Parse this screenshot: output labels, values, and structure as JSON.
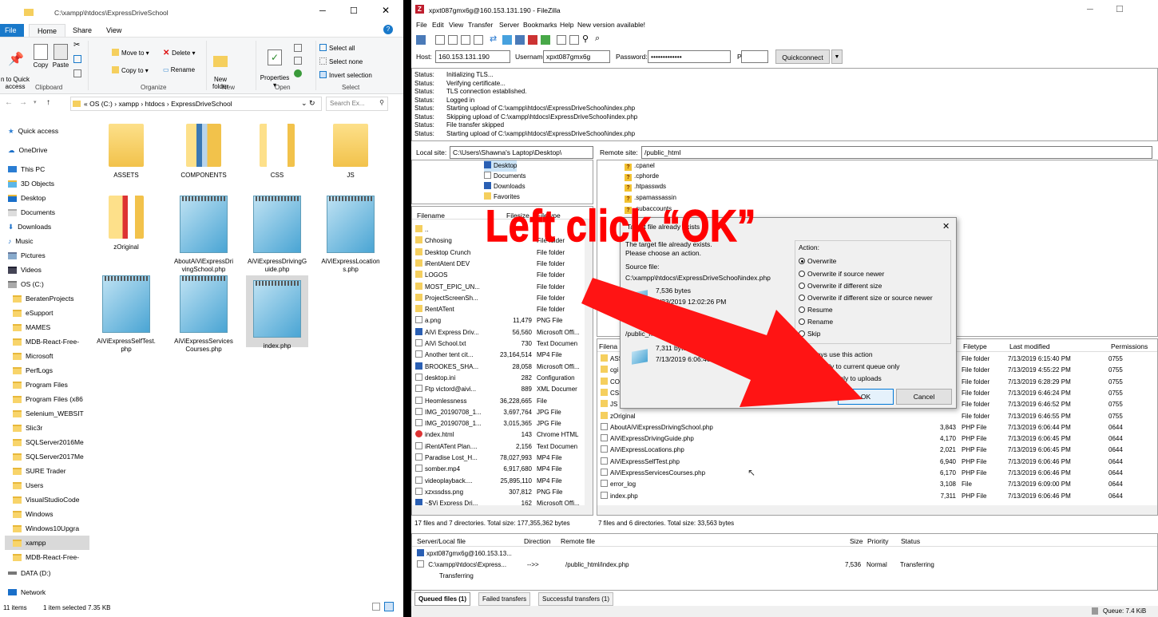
{
  "explorer": {
    "title": "C:\\xampp\\htdocs\\ExpressDriveSchool",
    "menu": [
      "File",
      "Home",
      "Share",
      "View"
    ],
    "ribbon": {
      "pin": "n to Quick\naccess",
      "copy": "Copy",
      "paste": "Paste",
      "move_to": "Move to ▾",
      "copy_to": "Copy to ▾",
      "delete": "Delete ▾",
      "rename": "Rename",
      "new_folder": "New\nfolder",
      "properties": "Properties\n▾",
      "select_all": "Select all",
      "select_none": "Select none",
      "invert_selection": "Invert selection",
      "groups": [
        "Clipboard",
        "Organize",
        "New",
        "Open",
        "Select"
      ]
    },
    "breadcrumb": "« OS (C:)  ›  xampp  ›  htdocs  ›  ExpressDriveSchool",
    "search_placeholder": "Search Ex...",
    "nav": [
      "Quick access",
      "OneDrive",
      "This PC",
      "3D Objects",
      "Desktop",
      "Documents",
      "Downloads",
      "Music",
      "Pictures",
      "Videos",
      "OS (C:)",
      "BeratenProjects",
      "eSupport",
      "MAMES",
      "MDB-React-Free-",
      "Microsoft",
      "PerfLogs",
      "Program Files",
      "Program Files (x86",
      "Selenium_WEBSIT",
      "Slic3r",
      "SQLServer2016Me",
      "SQLServer2017Me",
      "SURE Trader",
      "Users",
      "VisualStudioCode",
      "Windows",
      "Windows10Upgra",
      "xampp",
      "MDB-React-Free-",
      "DATA (D:)",
      "Network"
    ],
    "files": [
      "ASSETS",
      "COMPONENTS",
      "CSS",
      "JS",
      "zOriginal",
      "AboutAiViExpressDrivingSchool.php",
      "AiViExpressDrivingGuide.php",
      "AiViExpressLocations.php",
      "AiViExpressSelfTest.php",
      "AiViExpressServicesCourses.php",
      "index.php"
    ],
    "status_items": "11 items",
    "status_selected": "1 item selected  7.35 KB"
  },
  "fz": {
    "title": "xpxt087gmx6g@160.153.131.190 - FileZilla",
    "menu": [
      "File",
      "Edit",
      "View",
      "Transfer",
      "Server",
      "Bookmarks",
      "Help",
      "New version available!"
    ],
    "host_label": "Host:",
    "host": "160.153.131.190",
    "user_label": "Username:",
    "user": "xpxt087gmx6g",
    "pass_label": "Password:",
    "pass": "•••••••••••••",
    "port_label": "Port:",
    "quickconnect": "Quickconnect",
    "log": [
      [
        "Status:",
        "Initializing TLS..."
      ],
      [
        "Status:",
        "Verifying certificate..."
      ],
      [
        "Status:",
        "TLS connection established."
      ],
      [
        "Status:",
        "Logged in"
      ],
      [
        "Status:",
        "Starting upload of C:\\xampp\\htdocs\\ExpressDriveSchool\\index.php"
      ],
      [
        "Status:",
        "Skipping upload of C:\\xampp\\htdocs\\ExpressDriveSchool\\index.php"
      ],
      [
        "Status:",
        "File transfer skipped"
      ],
      [
        "Status:",
        "Starting upload of C:\\xampp\\htdocs\\ExpressDriveSchool\\index.php"
      ]
    ],
    "local_site_label": "Local site:",
    "local_site": "C:\\Users\\Shawna's Laptop\\Desktop\\",
    "remote_site_label": "Remote site:",
    "remote_site": "/public_html",
    "local_tree": [
      "Desktop",
      "Documents",
      "Downloads",
      "Favorites"
    ],
    "remote_tree": [
      ".cpanel",
      ".cphorde",
      ".htpasswds",
      ".spamassassin",
      ".subaccounts"
    ],
    "local_headers": [
      "Filename",
      "Filesize",
      "Filetype"
    ],
    "local_files": [
      [
        "..",
        "",
        ""
      ],
      [
        "Chhosing",
        "",
        "File folder"
      ],
      [
        "Desktop Crunch",
        "",
        "File folder"
      ],
      [
        "iRentAtent DEV",
        "",
        "File folder"
      ],
      [
        "LOGOS",
        "",
        "File folder"
      ],
      [
        "MOST_EPIC_UN...",
        "",
        "File folder"
      ],
      [
        "ProjectScreenSh...",
        "",
        "File folder"
      ],
      [
        "RentATent",
        "",
        "File folder"
      ],
      [
        "a.png",
        "11,479",
        "PNG File"
      ],
      [
        "AiVi Express Driv...",
        "56,560",
        "Microsoft Offi..."
      ],
      [
        "AiVi School.txt",
        "730",
        "Text Documen"
      ],
      [
        "Another tent cit...",
        "23,164,514",
        "MP4 File"
      ],
      [
        "BROOKES_SHA...",
        "28,058",
        "Microsoft Offi..."
      ],
      [
        "desktop.ini",
        "282",
        "Configuration"
      ],
      [
        "Ftp victord@aivi...",
        "889",
        "XML Documer"
      ],
      [
        "Heomlessness",
        "36,228,665",
        "File"
      ],
      [
        "IMG_20190708_1...",
        "3,697,764",
        "JPG File"
      ],
      [
        "IMG_20190708_1...",
        "3,015,365",
        "JPG File"
      ],
      [
        "index.html",
        "143",
        "Chrome HTML"
      ],
      [
        "iRentATent Plan....",
        "2,156",
        "Text Documen"
      ],
      [
        "Paradise Lost_H...",
        "78,027,993",
        "MP4 File"
      ],
      [
        "somber.mp4",
        "6,917,680",
        "MP4 File"
      ],
      [
        "videoplayback....",
        "25,895,110",
        "MP4 File"
      ],
      [
        "xzxssdss.png",
        "307,812",
        "PNG File"
      ],
      [
        "~$Vi Express Dri...",
        "162",
        "Microsoft Offi..."
      ]
    ],
    "remote_headers": [
      "Filena",
      "Filetype",
      "Last modified",
      "Permissions"
    ],
    "remote_files": [
      [
        "ASS",
        "",
        "File folder",
        "7/13/2019 6:15:40 PM",
        "0755"
      ],
      [
        "cgi",
        "",
        "File folder",
        "7/13/2019 4:55:22 PM",
        "0755"
      ],
      [
        "CO",
        "",
        "File folder",
        "7/13/2019 6:28:29 PM",
        "0755"
      ],
      [
        "CSS",
        "",
        "File folder",
        "7/13/2019 6:46:24 PM",
        "0755"
      ],
      [
        "JS",
        "",
        "File folder",
        "7/13/2019 6:46:52 PM",
        "0755"
      ],
      [
        "zOriginal",
        "",
        "File folder",
        "7/13/2019 6:46:55 PM",
        "0755"
      ],
      [
        "AboutAiViExpressDrivingSchool.php",
        "3,843",
        "PHP File",
        "7/13/2019 6:06:44 PM",
        "0644"
      ],
      [
        "AiViExpressDrivingGuide.php",
        "4,170",
        "PHP File",
        "7/13/2019 6:06:45 PM",
        "0644"
      ],
      [
        "AiViExpressLocations.php",
        "2,021",
        "PHP File",
        "7/13/2019 6:06:45 PM",
        "0644"
      ],
      [
        "AiViExpressSelfTest.php",
        "6,940",
        "PHP File",
        "7/13/2019 6:06:46 PM",
        "0644"
      ],
      [
        "AiViExpressServicesCourses.php",
        "6,170",
        "PHP File",
        "7/13/2019 6:06:46 PM",
        "0644"
      ],
      [
        "error_log",
        "3,108",
        "File",
        "7/13/2019 6:09:00 PM",
        "0644"
      ],
      [
        "index.php",
        "7,311",
        "PHP File",
        "7/13/2019 6:06:46 PM",
        "0644"
      ]
    ],
    "local_status": "17 files and 7 directories. Total size: 177,355,362 bytes",
    "remote_status": "7 files and 6 directories. Total size: 33,563 bytes",
    "queue_headers": [
      "Server/Local file",
      "Direction",
      "Remote file",
      "Size",
      "Priority",
      "Status"
    ],
    "queue_server": "xpxt087gmx6g@160.153.13...",
    "queue_local": "C:\\xampp\\htdocs\\Express...",
    "queue_direction": "-->>",
    "queue_remote": "/public_html/index.php",
    "queue_size": "7,536",
    "queue_priority": "Normal",
    "queue_status": "Transferring",
    "queue_sub": "Transferring",
    "tabs": [
      "Queued files (1)",
      "Failed transfers",
      "Successful transfers (1)"
    ],
    "queue_total": "Queue: 7.4 KiB"
  },
  "dialog": {
    "title": "Target file already exists",
    "message": "The target file already exists.\nPlease choose an action.",
    "source_label": "Source file:",
    "source_path": "C:\\xampp\\htdocs\\ExpressDriveSchool\\index.php",
    "source_size": "7,536 bytes",
    "source_date": "4/23/2019 12:02:26 PM",
    "target_label": "Target file:",
    "target_path": "/public_html/index.php",
    "target_size": "7,311 bytes",
    "target_date": "7/13/2019 6:06:46 PM",
    "action_label": "Action:",
    "options": [
      "Overwrite",
      "Overwrite if source newer",
      "Overwrite if different size",
      "Overwrite if different size or source newer",
      "Resume",
      "Rename",
      "Skip"
    ],
    "always": "Always use this action",
    "current_queue": "Apply to current queue only",
    "uploads": "Apply only to uploads",
    "ok": "OK",
    "cancel": "Cancel"
  },
  "annotation": "Left click “OK”"
}
